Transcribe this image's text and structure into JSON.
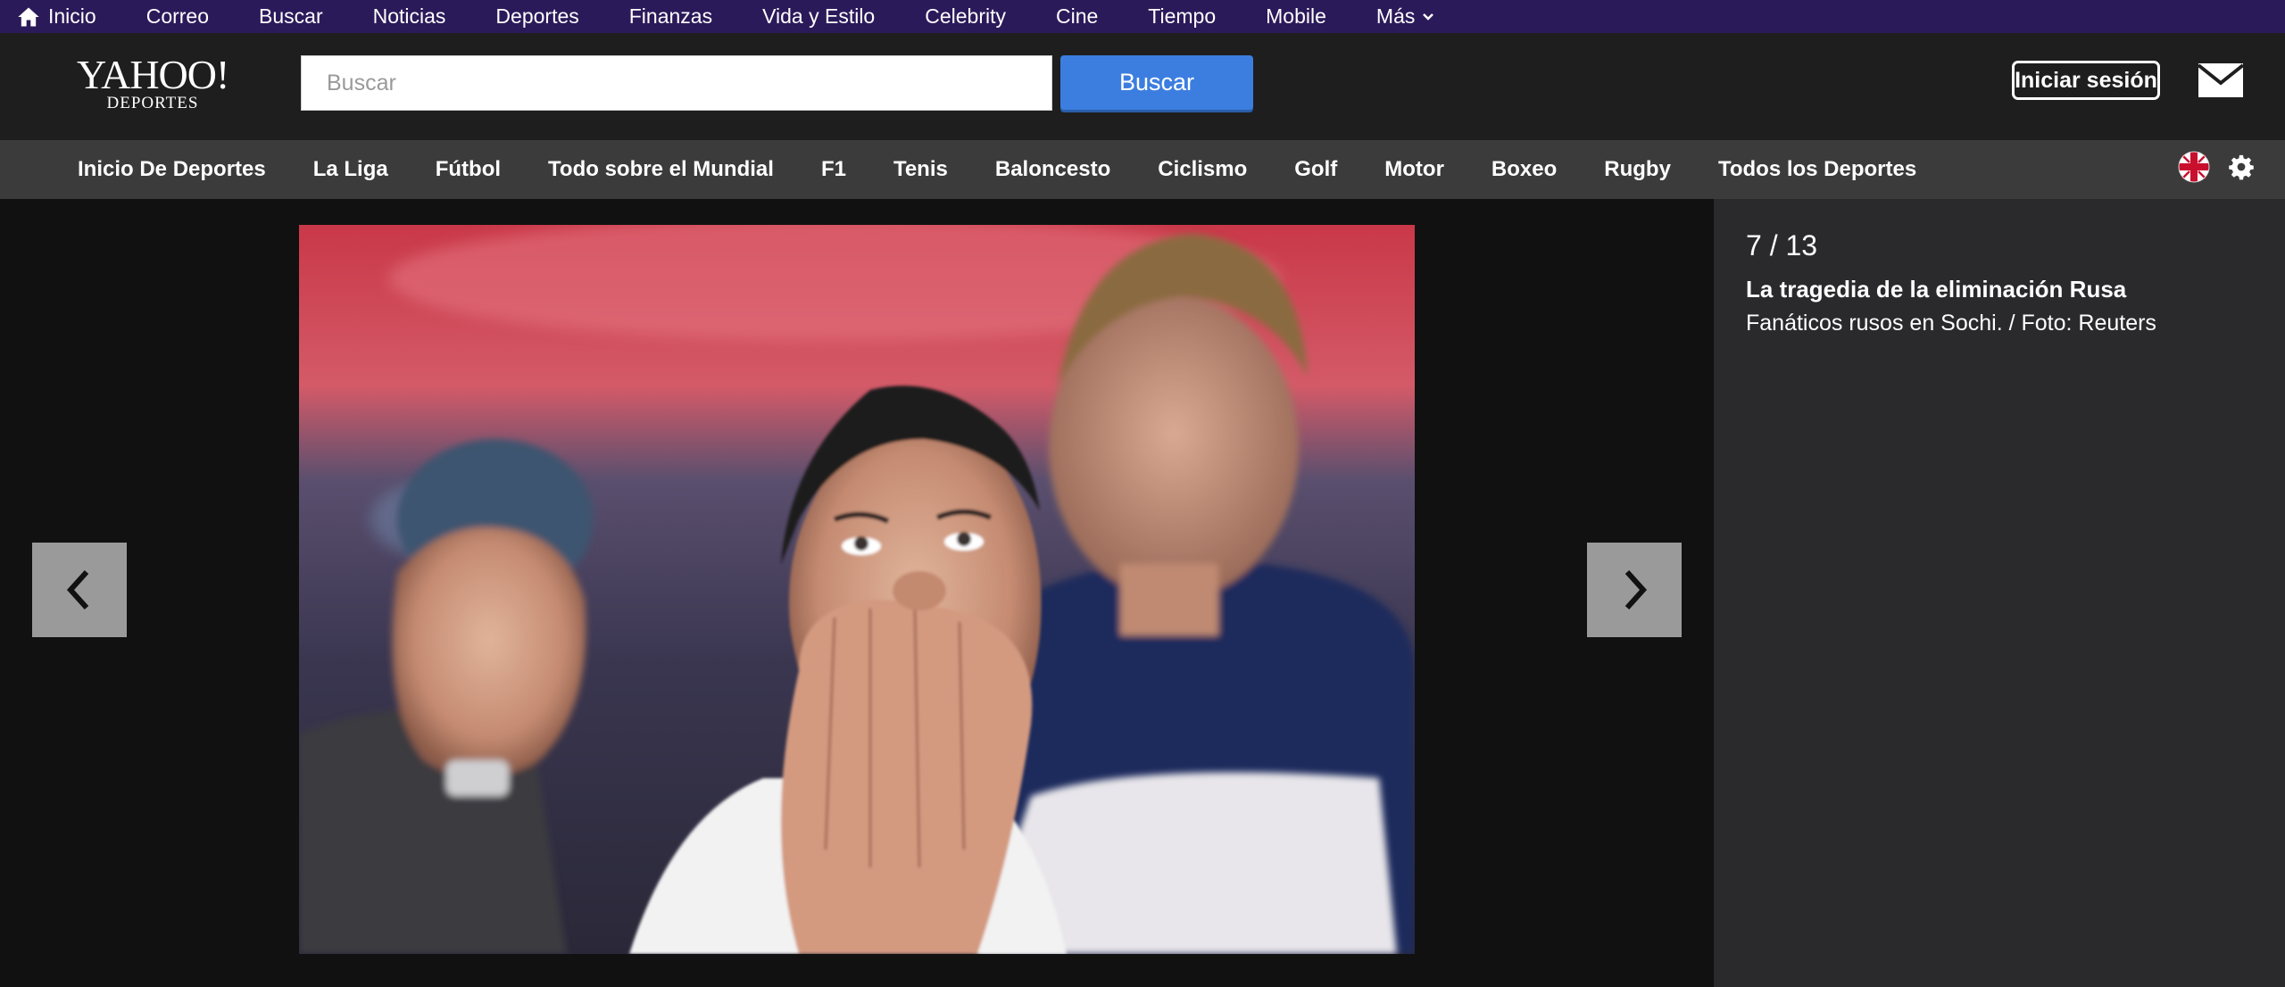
{
  "topbar": {
    "items": [
      {
        "label": "Inicio",
        "icon": "home-icon"
      },
      {
        "label": "Correo"
      },
      {
        "label": "Buscar"
      },
      {
        "label": "Noticias"
      },
      {
        "label": "Deportes"
      },
      {
        "label": "Finanzas"
      },
      {
        "label": "Vida y Estilo"
      },
      {
        "label": "Celebrity"
      },
      {
        "label": "Cine"
      },
      {
        "label": "Tiempo"
      },
      {
        "label": "Mobile"
      },
      {
        "label": "Más",
        "icon": "chevron-down-icon"
      }
    ]
  },
  "header": {
    "logo_main": "YAHOO!",
    "logo_sub": "DEPORTES",
    "search_placeholder": "Buscar",
    "search_button": "Buscar",
    "signin_label": "Iniciar sesión"
  },
  "sportsnav": {
    "items": [
      "Inicio De Deportes",
      "La Liga",
      "Fútbol",
      "Todo sobre el Mundial",
      "F1",
      "Tenis",
      "Baloncesto",
      "Ciclismo",
      "Golf",
      "Motor",
      "Boxeo",
      "Rugby",
      "Todos los Deportes"
    ]
  },
  "gallery": {
    "counter": "7 / 13",
    "title": "La tragedia de la eliminación Rusa",
    "caption": "Fanáticos rusos en Sochi. / Foto: Reuters"
  },
  "colors": {
    "topbar": "#2b1a5a",
    "header": "#1e1e1e",
    "sportsnav": "#3b3b3b",
    "accent": "#3c7ee0",
    "sidebar": "#2a2a2c"
  }
}
